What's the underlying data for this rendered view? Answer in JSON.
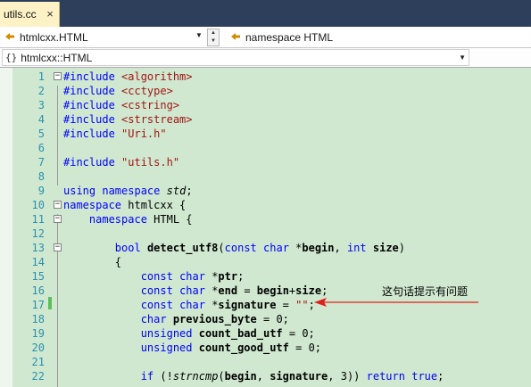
{
  "tab": {
    "title": "utils.cc",
    "close": "×"
  },
  "navigation": {
    "class_combo": {
      "icon": "class-icon",
      "value": "htmlcxx.HTML"
    },
    "member_combo": {
      "icon": "namespace-icon",
      "value": "namespace HTML"
    }
  },
  "scope": {
    "icon": "{}",
    "value": "htmlcxx::HTML"
  },
  "annotation": {
    "text": "这句话提示有问题",
    "arrow_color": "#e0201a"
  },
  "colors": {
    "background": "#cfe8cf",
    "keyword": "#0000ff",
    "string": "#a31515",
    "line_number": "#2b91af"
  },
  "code_lines": [
    {
      "n": "1",
      "fold": "⊟",
      "parts": [
        [
          "k",
          "#include"
        ],
        [
          "",
          " "
        ],
        [
          "s",
          "<algorithm>"
        ]
      ]
    },
    {
      "n": "2",
      "parts": [
        [
          "k",
          "#include"
        ],
        [
          "",
          " "
        ],
        [
          "s",
          "<cctype>"
        ]
      ]
    },
    {
      "n": "3",
      "parts": [
        [
          "k",
          "#include"
        ],
        [
          "",
          " "
        ],
        [
          "s",
          "<cstring>"
        ]
      ]
    },
    {
      "n": "4",
      "parts": [
        [
          "k",
          "#include"
        ],
        [
          "",
          " "
        ],
        [
          "s",
          "<strstream>"
        ]
      ]
    },
    {
      "n": "5",
      "parts": [
        [
          "k",
          "#include"
        ],
        [
          "",
          " "
        ],
        [
          "s",
          "\"Uri.h\""
        ]
      ]
    },
    {
      "n": "6",
      "parts": []
    },
    {
      "n": "7",
      "parts": [
        [
          "k",
          "#include"
        ],
        [
          "",
          " "
        ],
        [
          "s",
          "\"utils.h\""
        ]
      ]
    },
    {
      "n": "8",
      "parts": []
    },
    {
      "n": "9",
      "parts": [
        [
          "k",
          "using"
        ],
        [
          "",
          " "
        ],
        [
          "k",
          "namespace"
        ],
        [
          "",
          " "
        ],
        [
          "i",
          "std"
        ],
        [
          "",
          ";"
        ]
      ]
    },
    {
      "n": "10",
      "fold": "⊟",
      "parts": [
        [
          "k",
          "namespace"
        ],
        [
          "",
          " htmlcxx {"
        ]
      ]
    },
    {
      "n": "11",
      "fold": "⊟",
      "parts": [
        [
          "",
          "    "
        ],
        [
          "k",
          "namespace"
        ],
        [
          "",
          " HTML {"
        ]
      ]
    },
    {
      "n": "12",
      "parts": []
    },
    {
      "n": "13",
      "fold": "⊟",
      "parts": [
        [
          "",
          "        "
        ],
        [
          "k",
          "bool"
        ],
        [
          "",
          " "
        ],
        [
          "b",
          "detect_utf8"
        ],
        [
          "",
          "("
        ],
        [
          "k",
          "const"
        ],
        [
          "",
          " "
        ],
        [
          "k",
          "char"
        ],
        [
          "",
          " *"
        ],
        [
          "b",
          "begin"
        ],
        [
          "",
          ", "
        ],
        [
          "k",
          "int"
        ],
        [
          "",
          " "
        ],
        [
          "b",
          "size"
        ],
        [
          "",
          ")"
        ]
      ]
    },
    {
      "n": "14",
      "parts": [
        [
          "",
          "        {"
        ]
      ]
    },
    {
      "n": "15",
      "parts": [
        [
          "",
          "            "
        ],
        [
          "k",
          "const"
        ],
        [
          "",
          " "
        ],
        [
          "k",
          "char"
        ],
        [
          "",
          " *"
        ],
        [
          "b",
          "ptr"
        ],
        [
          "",
          ";"
        ]
      ]
    },
    {
      "n": "16",
      "parts": [
        [
          "",
          "            "
        ],
        [
          "k",
          "const"
        ],
        [
          "",
          " "
        ],
        [
          "k",
          "char"
        ],
        [
          "",
          " *"
        ],
        [
          "b",
          "end"
        ],
        [
          "",
          " = "
        ],
        [
          "b",
          "begin"
        ],
        [
          "",
          "+"
        ],
        [
          "b",
          "size"
        ],
        [
          "",
          ";"
        ]
      ]
    },
    {
      "n": "17",
      "parts": [
        [
          "",
          "            "
        ],
        [
          "k",
          "const"
        ],
        [
          "",
          " "
        ],
        [
          "k",
          "char"
        ],
        [
          "",
          " *"
        ],
        [
          "b",
          "signature"
        ],
        [
          "",
          " = "
        ],
        [
          "s",
          "\"\""
        ],
        [
          "",
          ";"
        ]
      ]
    },
    {
      "n": "18",
      "parts": [
        [
          "",
          "            "
        ],
        [
          "k",
          "char"
        ],
        [
          "",
          " "
        ],
        [
          "b",
          "previous_byte"
        ],
        [
          "",
          " = 0;"
        ]
      ]
    },
    {
      "n": "19",
      "parts": [
        [
          "",
          "            "
        ],
        [
          "k",
          "unsigned"
        ],
        [
          "",
          " "
        ],
        [
          "b",
          "count_bad_utf"
        ],
        [
          "",
          " = 0;"
        ]
      ]
    },
    {
      "n": "20",
      "parts": [
        [
          "",
          "            "
        ],
        [
          "k",
          "unsigned"
        ],
        [
          "",
          " "
        ],
        [
          "b",
          "count_good_utf"
        ],
        [
          "",
          " = 0;"
        ]
      ]
    },
    {
      "n": "21",
      "parts": []
    },
    {
      "n": "22",
      "parts": [
        [
          "",
          "            "
        ],
        [
          "k",
          "if"
        ],
        [
          "",
          " (!"
        ],
        [
          "i",
          "strncmp"
        ],
        [
          "",
          "("
        ],
        [
          "b",
          "begin"
        ],
        [
          "",
          ", "
        ],
        [
          "b",
          "signature"
        ],
        [
          "",
          ", 3)) "
        ],
        [
          "k",
          "return"
        ],
        [
          "",
          " "
        ],
        [
          "k",
          "true"
        ],
        [
          "",
          ";"
        ]
      ]
    }
  ]
}
